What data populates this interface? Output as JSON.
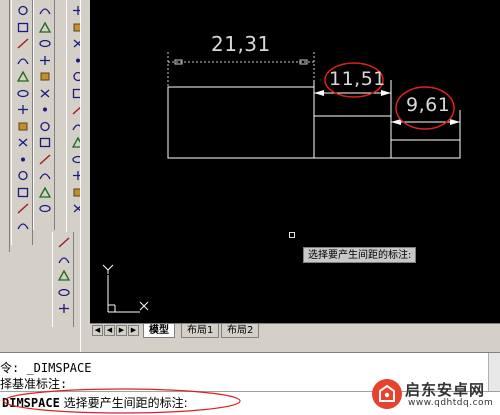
{
  "drawing": {
    "dim_overall": "21,31",
    "dim_middle": "11,51",
    "dim_right": "9,61",
    "tooltip": "选择要产生间距的标注:",
    "ucs_y_label": "Y",
    "ucs_x_label": "X"
  },
  "tabs": {
    "items": [
      {
        "label": "模型",
        "active": true
      },
      {
        "label": "布局1",
        "active": false
      },
      {
        "label": "布局2",
        "active": false
      }
    ]
  },
  "command": {
    "line1": "令: _DIMSPACE",
    "line2": "择基准标注:",
    "line3_cmd": "DIMSPACE",
    "line3_prompt": " 选择要产生间距的标注:"
  },
  "watermark": {
    "title": "启东安卓网",
    "url": "www.qdhtdq.com"
  },
  "colors": {
    "canvas": "#000000",
    "linework": "#ffffff",
    "annotation_circle": "#e02020",
    "ui_gray": "#d4d0c8"
  }
}
